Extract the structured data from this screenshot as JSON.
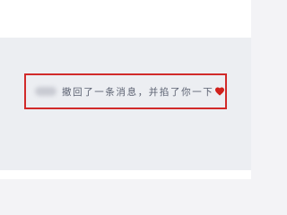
{
  "chat": {
    "recall_notice": {
      "text": "撤回了一条消息，并掐了你一下",
      "emoji_icon": "heart-icon",
      "emoji_color": "#d0211c"
    },
    "highlight_color": "#d12a2a"
  }
}
